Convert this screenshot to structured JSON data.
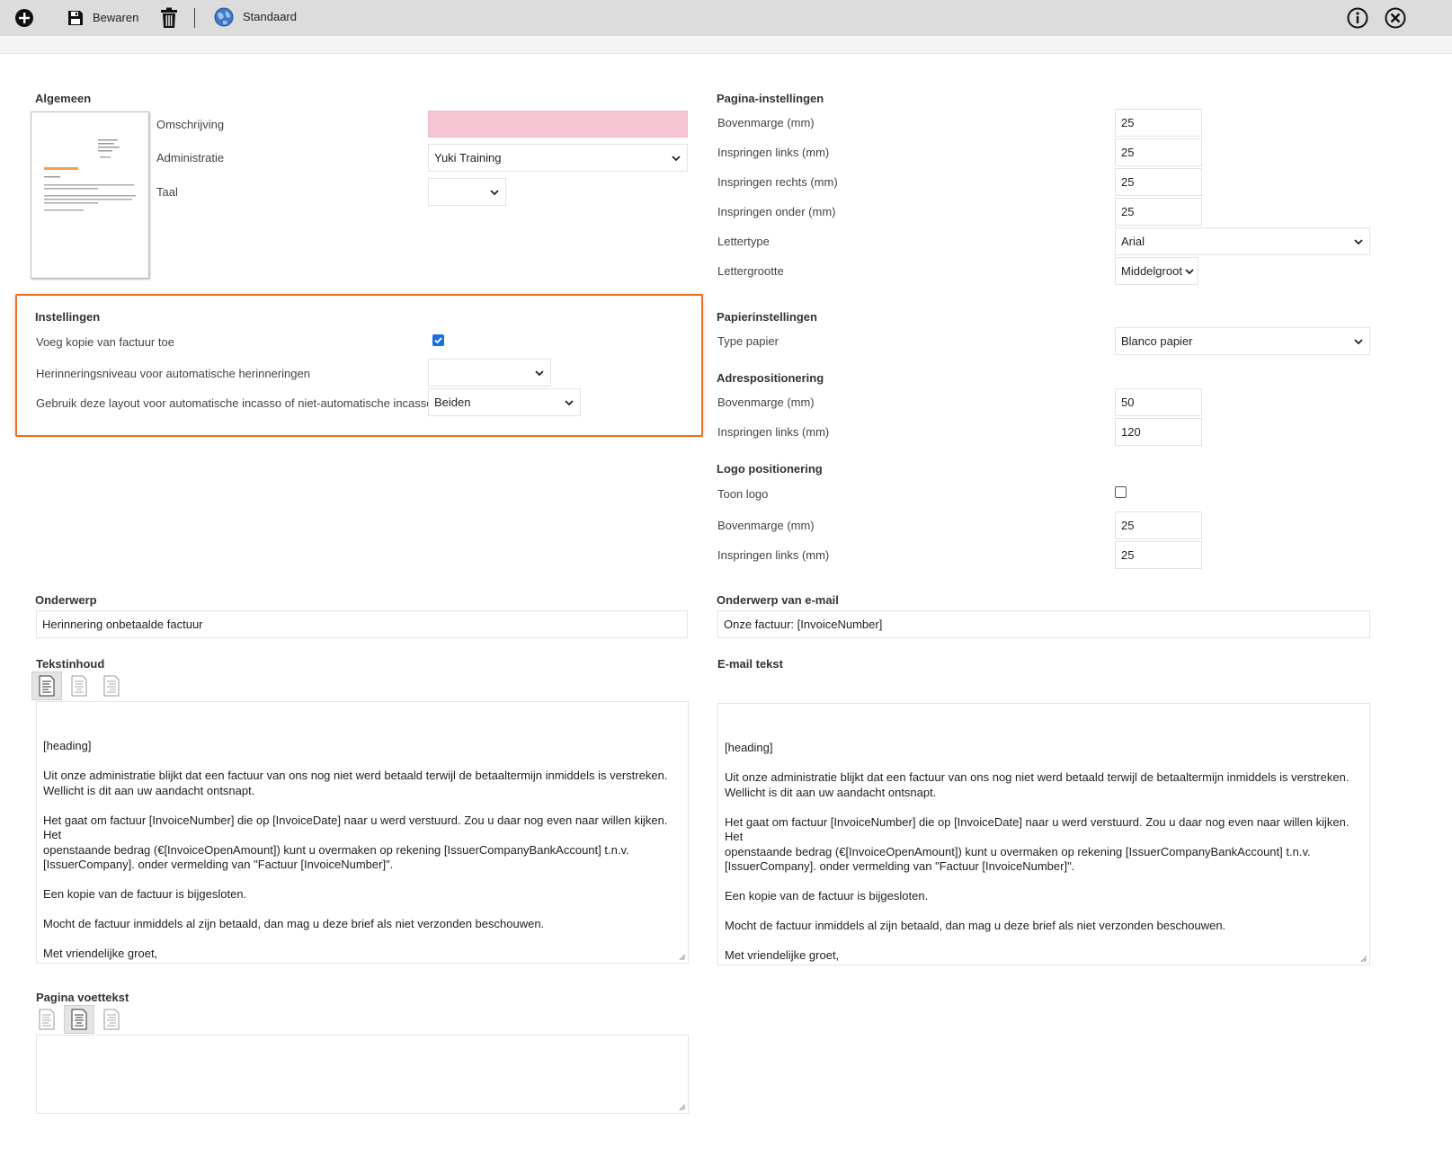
{
  "toolbar": {
    "add_icon": "plus-circle-icon",
    "save_label": "Bewaren",
    "save_icon": "floppy-disk-icon",
    "delete_icon": "trash-icon",
    "default_label": "Standaard",
    "default_icon": "globe-icon",
    "info_icon": "info-circle-icon",
    "close_icon": "close-circle-icon"
  },
  "algemeen": {
    "title": "Algemeen",
    "omschrijving_label": "Omschrijving",
    "omschrijving_value": "",
    "administratie_label": "Administratie",
    "administratie_value": "Yuki Training",
    "taal_label": "Taal",
    "taal_value": ""
  },
  "instellingen": {
    "title": "Instellingen",
    "kopie_label": "Voeg kopie van factuur toe",
    "herinneringsniveau_label": "Herinneringsniveau voor automatische herinneringen",
    "herinneringsniveau_value": "",
    "incasso_label": "Gebruik deze layout voor automatische incasso of niet-automatische incasso?",
    "incasso_value": "Beiden"
  },
  "pagina_instellingen": {
    "title": "Pagina-instellingen",
    "fields": [
      {
        "label": "Bovenmarge (mm)",
        "value": "25"
      },
      {
        "label": "Inspringen links (mm)",
        "value": "25"
      },
      {
        "label": "Inspringen rechts (mm)",
        "value": "25"
      },
      {
        "label": "Inspringen onder (mm)",
        "value": "25"
      }
    ],
    "lettertype_label": "Lettertype",
    "lettertype_value": "Arial",
    "lettergrootte_label": "Lettergrootte",
    "lettergrootte_value": "Middelgroot"
  },
  "papier": {
    "title": "Papierinstellingen",
    "type_label": "Type papier",
    "type_value": "Blanco papier"
  },
  "adres": {
    "title": "Adrespositionering",
    "fields": [
      {
        "label": "Bovenmarge (mm)",
        "value": "50"
      },
      {
        "label": "Inspringen links (mm)",
        "value": "120"
      }
    ]
  },
  "logo": {
    "title": "Logo positionering",
    "toon_label": "Toon logo",
    "fields": [
      {
        "label": "Bovenmarge (mm)",
        "value": "25"
      },
      {
        "label": "Inspringen links (mm)",
        "value": "25"
      }
    ]
  },
  "onderwerp": {
    "title": "Onderwerp",
    "value": "Herinnering onbetaalde factuur"
  },
  "onderwerp_email": {
    "title": "Onderwerp van e-mail",
    "value": "Onze factuur: [InvoiceNumber]"
  },
  "tekstinhoud": {
    "title": "Tekstinhoud",
    "body": "[heading]\n\nUit onze administratie blijkt dat een factuur van ons nog niet werd betaald terwijl de betaaltermijn inmiddels is verstreken.\nWellicht is dit aan uw aandacht ontsnapt.\n\nHet gaat om factuur [InvoiceNumber] die op [InvoiceDate] naar u werd verstuurd. Zou u daar nog even naar willen kijken. Het\nopenstaande bedrag (€[InvoiceOpenAmount]) kunt u overmaken op rekening [IssuerCompanyBankAccount] t.n.v.\n[IssuerCompany]. onder vermelding van \"Factuur [InvoiceNumber]\".\n\nEen kopie van de factuur is bijgesloten.\n\nMocht de factuur inmiddels al zijn betaald, dan mag u deze brief als niet verzonden beschouwen.\n\nMet vriendelijke groet,\n\n[IssuerCompany]"
  },
  "email_tekst": {
    "title": "E-mail tekst",
    "body": "[heading]\n\nUit onze administratie blijkt dat een factuur van ons nog niet werd betaald terwijl de betaaltermijn inmiddels is verstreken.\nWellicht is dit aan uw aandacht ontsnapt.\n\nHet gaat om factuur [InvoiceNumber] die op [InvoiceDate] naar u werd verstuurd. Zou u daar nog even naar willen kijken. Het\nopenstaande bedrag (€[InvoiceOpenAmount]) kunt u overmaken op rekening [IssuerCompanyBankAccount] t.n.v.\n[IssuerCompany]. onder vermelding van \"Factuur [InvoiceNumber]\".\n\nEen kopie van de factuur is bijgesloten.\n\nMocht de factuur inmiddels al zijn betaald, dan mag u deze brief als niet verzonden beschouwen.\n\nMet vriendelijke groet,\n\n[IssuerCompany]"
  },
  "voettekst": {
    "title": "Pagina voettekst",
    "body": ""
  },
  "colors": {
    "highlight": "#e8702a",
    "required_field": "#f6c6d4",
    "checkbox_checked": "#1a6ee0",
    "toolbar_bg": "#dcdcdc"
  }
}
